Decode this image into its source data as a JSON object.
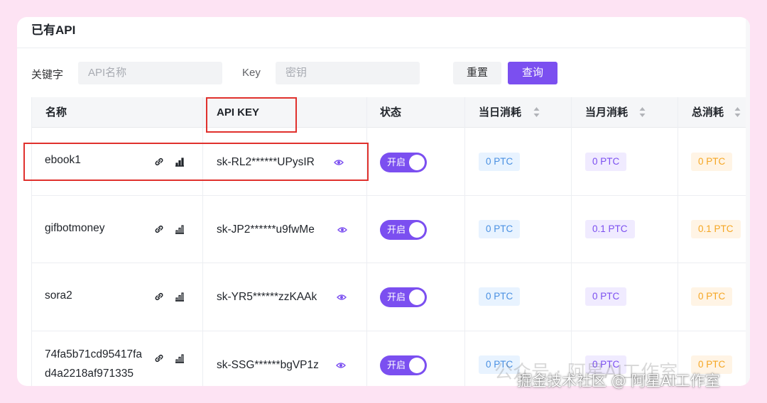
{
  "section": {
    "title": "已有API"
  },
  "filters": {
    "keyword_label": "关键字",
    "keyword_placeholder": "API名称",
    "key_label": "Key",
    "key_placeholder": "密钥",
    "reset_label": "重置",
    "query_label": "查询"
  },
  "table": {
    "headers": {
      "name": "名称",
      "api_key": "API KEY",
      "status": "状态",
      "daily": "当日消耗",
      "monthly": "当月消耗",
      "total": "总消耗"
    },
    "rows": [
      {
        "name": "ebook1",
        "key": "sk-RL2******UPysIR",
        "status": "开启",
        "daily": "0 PTC",
        "monthly": "0 PTC",
        "total": "0 PTC"
      },
      {
        "name": "gifbotmoney",
        "key": "sk-JP2******u9fwMe",
        "status": "开启",
        "daily": "0 PTC",
        "monthly": "0.1 PTC",
        "total": "0.1 PTC"
      },
      {
        "name": "sora2",
        "key": "sk-YR5******zzKAAk",
        "status": "开启",
        "daily": "0 PTC",
        "monthly": "0 PTC",
        "total": "0 PTC"
      },
      {
        "name_line1": "74fa5b71cd95417fa",
        "name_line2": "d4a2218af971335",
        "key": "sk-SSG******bgVP1z",
        "status": "开启",
        "daily": "0 PTC",
        "monthly": "0 PTC",
        "total": "0 PTC"
      }
    ]
  },
  "watermark": {
    "line1": "公众号 · 阿星AI工作室",
    "line2": "掘金技术社区 @ 阿星AI工作室"
  },
  "colors": {
    "accent": "#7b4ff0",
    "highlight_box": "#e0312d",
    "badge_blue": "#4a90e2",
    "badge_purple": "#7b4ff0",
    "badge_orange": "#f5a623"
  },
  "icons": [
    "link-icon",
    "stats-icon",
    "eye-icon",
    "sort-icon"
  ]
}
